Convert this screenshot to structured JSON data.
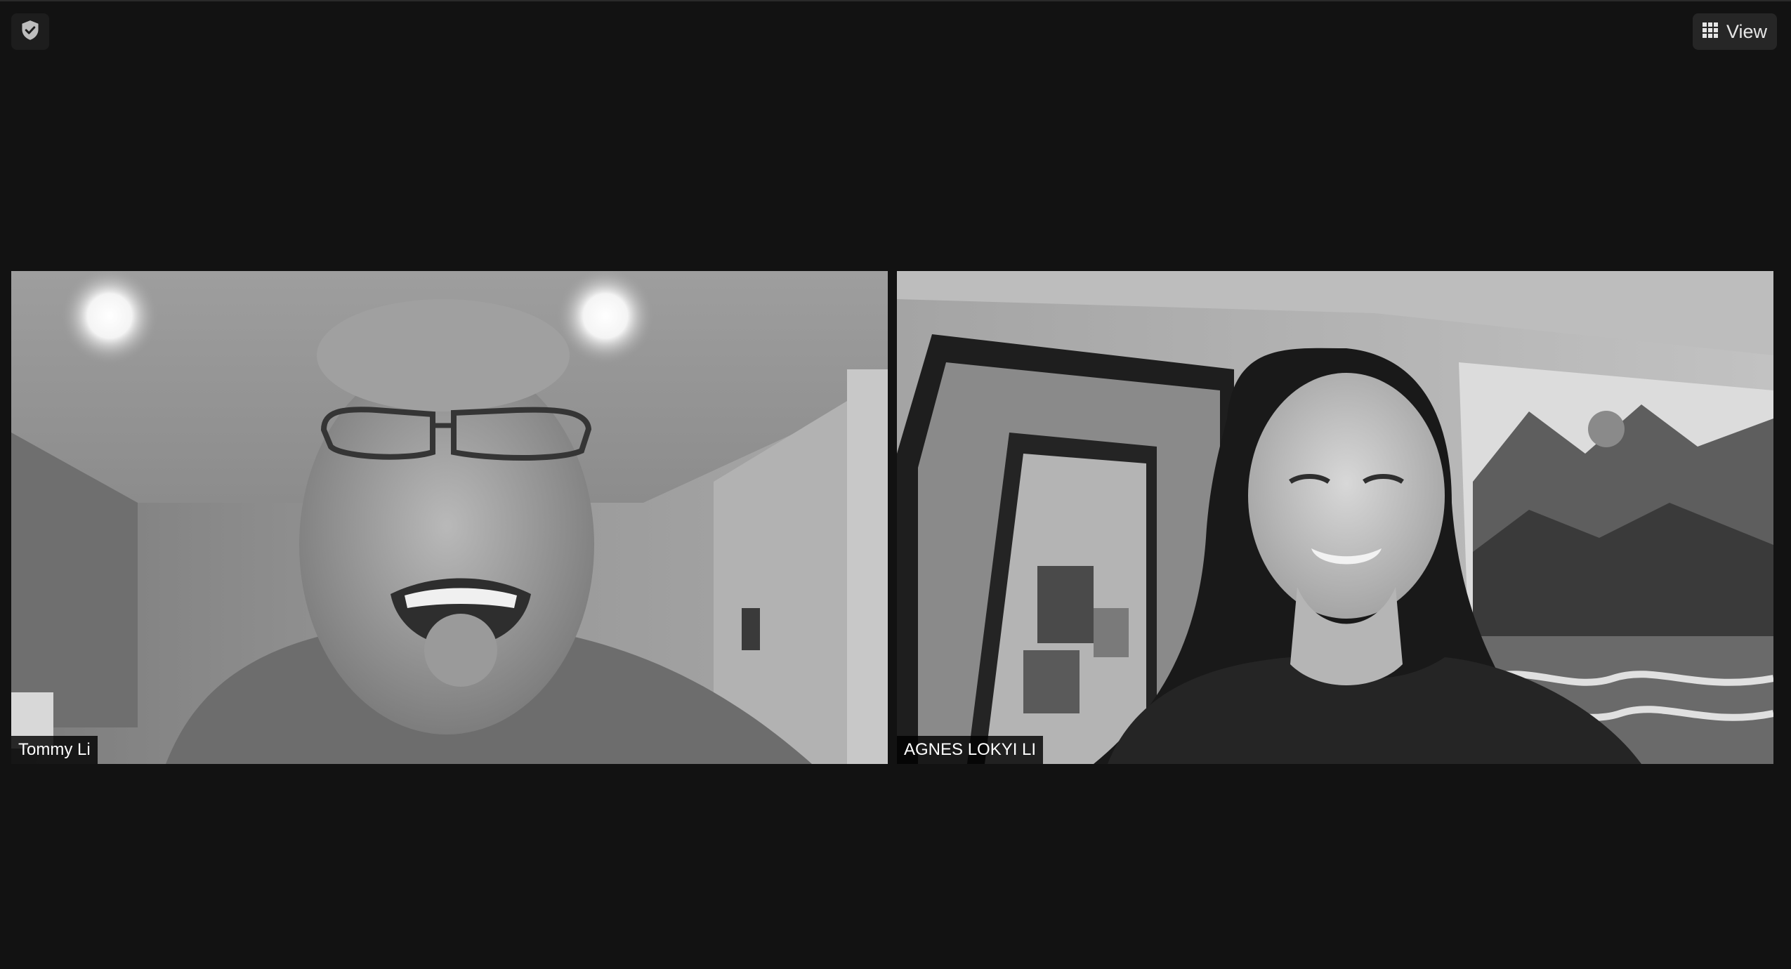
{
  "toolbar": {
    "security_icon": "shield-check-icon",
    "view_icon": "grid-icon",
    "view_label": "View"
  },
  "participants": [
    {
      "name": "Tommy Li",
      "video": "grayscale webcam feed"
    },
    {
      "name": "AGNES LOKYI LI",
      "video": "grayscale webcam feed"
    }
  ],
  "colors": {
    "background": "#121212",
    "button_bg": "#262626",
    "name_tag_bg": "#000000",
    "text": "#ffffff"
  }
}
